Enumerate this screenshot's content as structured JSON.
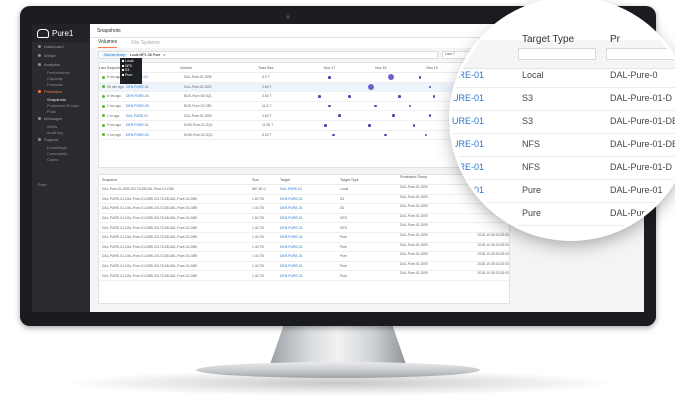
{
  "app": {
    "brand": "Pure1",
    "page_title": "Snapshots"
  },
  "sidebar": {
    "items": [
      {
        "label": "Dashboard",
        "active": false,
        "subs": []
      },
      {
        "label": "Arrays",
        "active": false,
        "subs": []
      },
      {
        "label": "Analytics",
        "active": false,
        "subs": [
          "Performance",
          "Capacity",
          "Forecast"
        ]
      },
      {
        "label": "Protection",
        "active": true,
        "subs": [
          "Snapshots",
          "Protection Groups",
          "Pods"
        ]
      },
      {
        "label": "Messages",
        "active": false,
        "subs": [
          "Alerts",
          "Audit log"
        ]
      },
      {
        "label": "Support",
        "active": false,
        "subs": [
          "Knowledge",
          "Community",
          "Cases"
        ]
      }
    ],
    "footer": "Pure"
  },
  "tabs": [
    {
      "label": "Volumes",
      "active": true
    },
    {
      "label": "File Systems",
      "active": false
    }
  ],
  "filter": {
    "chip": "Source Array",
    "text": "Louis MPL 08 Pure"
  },
  "filter_popup": [
    "Local",
    "NFS",
    "S3",
    "Pure"
  ],
  "sort_box": "Last 7",
  "volumes_table": {
    "headers": [
      "Last Snapshot",
      "Source",
      "Volume",
      "Total Size",
      "Nov 17",
      "Nov 18",
      "Nov 19",
      "Nov 20"
    ],
    "rows": [
      {
        "time": "5 hrs ago",
        "source": "DAL-PURE-01",
        "volume": "DAL-Pure-01-DB8",
        "size": "6.9 T",
        "dots": [
          0.1,
          0.4,
          0.55,
          0.8,
          0.92
        ],
        "big": 0.4
      },
      {
        "time": "30 min ago",
        "source": "DEH-PURE-01",
        "volume": "DAL-Pure-01-DB2",
        "size": "2.60 T",
        "dots": [
          0.3,
          0.6,
          0.75
        ],
        "big": 0.3,
        "selected": true
      },
      {
        "time": "8 hrs ago",
        "source": "DEH-PURE-04",
        "volume": "BOS-Pure-08 SQL",
        "size": "3.60 T",
        "dots": [
          0.05,
          0.2,
          0.45,
          0.62,
          0.9
        ]
      },
      {
        "time": "2 hrs ago",
        "source": "DEH-PURE-09",
        "volume": "BOS-Pure-02 ORL",
        "size": "11.8 T",
        "dots": [
          0.1,
          0.33,
          0.5,
          0.77
        ]
      },
      {
        "time": "1 hr ago",
        "source": "DAL-PURE-01",
        "volume": "DAL-Pure-01-DB9",
        "size": "2.60 T",
        "dots": [
          0.15,
          0.42,
          0.6,
          0.85
        ]
      },
      {
        "time": "3 hrs ago",
        "source": "DEH-PURE-01",
        "volume": "SGM-Pure-01-SQL",
        "size": "11.55 T",
        "dots": [
          0.08,
          0.3,
          0.52,
          0.7,
          0.95
        ]
      },
      {
        "time": "4 hrs ago",
        "source": "DEH-PURE-04",
        "volume": "SGM-Pure-02-SQL",
        "size": "8.40 T",
        "dots": [
          0.12,
          0.38,
          0.58,
          0.82
        ]
      }
    ]
  },
  "snapshots_table": {
    "headers": [
      "Snapshot",
      "Size",
      "Target",
      "Target Type",
      "Protection Group",
      "Created"
    ],
    "rows": [
      {
        "name": "DAL-Pure-01-DB9-20171108.DAL-Pure-01-DB9",
        "size": "887.80 G",
        "target": "DAL-PURE-01",
        "type": "Local",
        "group": "DAL-Pure-01-DB9",
        "created": ""
      },
      {
        "name": "DAL-PURE-01-DAL-Pure-01-DB9-20171108.DAL-Pure-01-DB9",
        "size": "1.60 TB",
        "target": "DEH-PURE-01",
        "type": "S3",
        "group": "DAL-Pure-01-DB9",
        "created": ""
      },
      {
        "name": "DAL-PURE-01-DAL-Pure-01-DB9-20171108.DAL-Pure-01-DB9",
        "size": "1.44 TB",
        "target": "DEH-PURE-01",
        "type": "S3",
        "group": "DAL-Pure-01-DB9",
        "created": ""
      },
      {
        "name": "DAL-PURE-01-DAL-Pure-01-DB9-20171108.DAL-Pure-01-DB9",
        "size": "1.64 TB",
        "target": "DEH-PURE-01",
        "type": "NFS",
        "group": "DAL-Pure-01-DB9",
        "created": ""
      },
      {
        "name": "DAL-PURE-01-DAL-Pure-01-DB9-20171108.DAL-Pure-01-DB9",
        "size": "1.44 TB",
        "target": "DEH-PURE-01",
        "type": "NFS",
        "group": "DAL-Pure-01-DB9",
        "created": ""
      },
      {
        "name": "DAL-PURE-01-DAL-Pure-01-DB9-20171108.DAL-Pure-01-DB9",
        "size": "1.44 TB",
        "target": "DEH-PURE-01",
        "type": "Pure",
        "group": "DAL-Pure-01-DB9",
        "created": "2018-10-08 03:25:00"
      },
      {
        "name": "DAL-PURE-01-DAL-Pure-01-DB9-20171108.DAL-Pure-01-DB9",
        "size": "1.44 TB",
        "target": "DEH-PURE-01",
        "type": "Pure",
        "group": "DAL-Pure-01-DB9",
        "created": "2018-10-08 03:25:00"
      },
      {
        "name": "DAL-PURE-01-DAL-Pure-01-DB9-20171108.DAL-Pure-01-DB9",
        "size": "1.44 TB",
        "target": "DEH-PURE-01",
        "type": "Pure",
        "group": "DAL-Pure-01-DB9",
        "created": "2018-10-08 03:25:00"
      },
      {
        "name": "DAL-PURE-01-DAL-Pure-01-DB9-20171108.DAL-Pure-01-DB9",
        "size": "1.44 TB",
        "target": "DEH-PURE-01",
        "type": "Pure",
        "group": "DAL-Pure-01-DB9",
        "created": "2018-10-08 03:25:00"
      },
      {
        "name": "DAL-PURE-01-DAL-Pure-01-DB9-20171108.DAL-Pure-01-DB9",
        "size": "1.44 TB",
        "target": "DEH-PURE-01",
        "type": "Pure",
        "group": "DAL-Pure-01-DB9",
        "created": "2018-10-08 03:25:00"
      }
    ]
  },
  "magnifier": {
    "col_target_type": "Target Type",
    "col_protection": "Pr",
    "rows": [
      {
        "target": "PURE-01",
        "type": "Local",
        "group": "DAL-Pure-0"
      },
      {
        "target": "PURE-01",
        "type": "S3",
        "group": "DAL-Pure-01-D"
      },
      {
        "target": "PURE-01",
        "type": "S3",
        "group": "DAL-Pure-01-DB"
      },
      {
        "target": "PURE-01",
        "type": "NFS",
        "group": "DAL-Pure-01-DB"
      },
      {
        "target": "PURE-01",
        "type": "NFS",
        "group": "DAL-Pure-01-D"
      },
      {
        "target": "PURE-01",
        "type": "Pure",
        "group": "DAL-Pure-01"
      },
      {
        "target": "01",
        "type": "Pure",
        "group": "DAL-Pure"
      },
      {
        "target": "",
        "type": "Pure",
        "group": "DAL-"
      },
      {
        "target": "",
        "type": "Pure",
        "group": ""
      }
    ]
  },
  "colors": {
    "accent": "#ff7a3d",
    "link": "#2a76cc",
    "sidebar_bg": "#2a2b2f",
    "status_ok": "#63b32e",
    "timeline_dot": "#4e4aa8"
  }
}
